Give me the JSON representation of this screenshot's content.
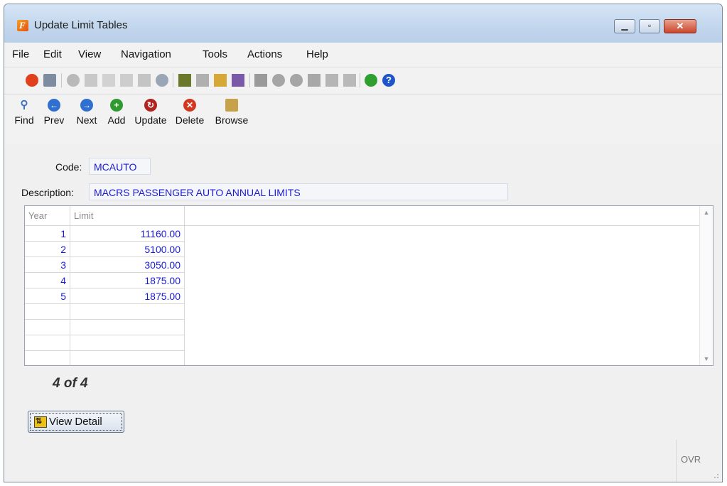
{
  "window": {
    "title": "Update Limit Tables"
  },
  "menu": {
    "items": [
      "File",
      "Edit",
      "View",
      "Navigation",
      "Tools",
      "Actions",
      "Help"
    ]
  },
  "toolbar": {
    "buttons": [
      {
        "label": "Find",
        "icon": "magnifier-icon",
        "color": "#3a6fc4"
      },
      {
        "label": "Prev",
        "icon": "arrow-left-circle-icon",
        "color": "#2f6fd0"
      },
      {
        "label": "Next",
        "icon": "arrow-right-circle-icon",
        "color": "#2f6fd0"
      },
      {
        "label": "Add",
        "icon": "plus-circle-icon",
        "color": "#2f9a2f"
      },
      {
        "label": "Update",
        "icon": "refresh-circle-icon",
        "color": "#b0231e"
      },
      {
        "label": "Delete",
        "icon": "x-circle-icon",
        "color": "#d2371f"
      },
      {
        "label": "Browse",
        "icon": "folder-icon",
        "color": "#c8a24a"
      }
    ]
  },
  "form": {
    "code_label": "Code:",
    "code_value": "MCAUTO",
    "description_label": "Description:",
    "description_value": "MACRS PASSENGER AUTO ANNUAL LIMITS"
  },
  "grid": {
    "columns": [
      "Year",
      "Limit"
    ],
    "rows": [
      {
        "year": "1",
        "limit": "11160.00"
      },
      {
        "year": "2",
        "limit": "5100.00"
      },
      {
        "year": "3",
        "limit": "3050.00"
      },
      {
        "year": "4",
        "limit": "1875.00"
      },
      {
        "year": "5",
        "limit": "1875.00"
      }
    ]
  },
  "record_count": "4 of 4",
  "view_detail_label": "View Detail",
  "status": {
    "ovr": "OVR"
  },
  "colors": {
    "field_text": "#1b1bd0",
    "title_gradient": "#c4d8ee",
    "close_button": "#c9462c"
  }
}
